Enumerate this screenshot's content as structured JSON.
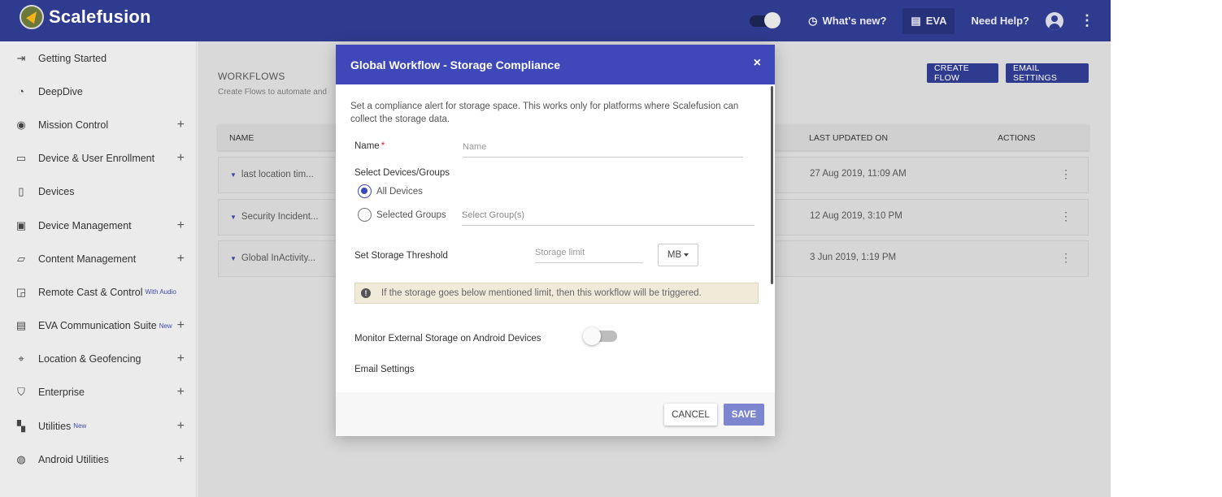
{
  "app": {
    "brand": "Scalefusion",
    "header": {
      "whats_new": "What's new?",
      "eva": "EVA",
      "need_help": "Need Help?"
    }
  },
  "sidebar": {
    "items": [
      {
        "label": "Getting Started",
        "icon": "sign-in-icon",
        "expandable": false,
        "badge": ""
      },
      {
        "label": "DeepDive",
        "icon": "gauge-icon",
        "expandable": false,
        "badge": ""
      },
      {
        "label": "Mission Control",
        "icon": "target-icon",
        "expandable": true,
        "badge": ""
      },
      {
        "label": "Device & User Enrollment",
        "icon": "devices-icon",
        "expandable": true,
        "badge": ""
      },
      {
        "label": "Devices",
        "icon": "phone-icon",
        "expandable": false,
        "badge": ""
      },
      {
        "label": "Device Management",
        "icon": "briefcase-icon",
        "expandable": true,
        "badge": ""
      },
      {
        "label": "Content Management",
        "icon": "folder-icon",
        "expandable": true,
        "badge": ""
      },
      {
        "label": "Remote Cast & Control",
        "icon": "cast-icon",
        "expandable": false,
        "badge": "With Audio"
      },
      {
        "label": "EVA Communication Suite",
        "icon": "chat-icon",
        "expandable": true,
        "badge": "New"
      },
      {
        "label": "Location & Geofencing",
        "icon": "map-pin-icon",
        "expandable": true,
        "badge": ""
      },
      {
        "label": "Enterprise",
        "icon": "shield-icon",
        "expandable": true,
        "badge": ""
      },
      {
        "label": "Utilities",
        "icon": "widgets-icon",
        "expandable": true,
        "badge": "New"
      },
      {
        "label": "Android Utilities",
        "icon": "android-icon",
        "expandable": true,
        "badge": ""
      }
    ],
    "plus": "+"
  },
  "workflows": {
    "title": "WORKFLOWS",
    "subtitle": "Create Flows to automate and",
    "create_flow": "CREATE FLOW",
    "email_settings": "EMAIL SETTINGS",
    "columns": {
      "name": "NAME",
      "last_updated": "LAST UPDATED ON",
      "actions": "ACTIONS"
    },
    "rows": [
      {
        "name": "last location tim...",
        "updated": "27 Aug 2019, 11:09 AM"
      },
      {
        "name": "Security Incident...",
        "updated": "12 Aug 2019, 3:10 PM"
      },
      {
        "name": "Global InActivity...",
        "updated": "3 Jun 2019, 1:19 PM"
      }
    ]
  },
  "modal": {
    "title": "Global Workflow - Storage Compliance",
    "close": "×",
    "description": "Set a compliance alert for storage space. This works only for platforms where Scalefusion can collect the storage data.",
    "name_label": "Name",
    "required_mark": "*",
    "name_placeholder": "Name",
    "select_label": "Select Devices/Groups",
    "opt_all": "All Devices",
    "opt_groups": "Selected Groups",
    "groups_placeholder": "Select Group(s)",
    "threshold_label": "Set Storage Threshold",
    "storage_placeholder": "Storage limit",
    "unit": "MB",
    "info_text": "If the storage goes below mentioned limit, then this workflow will be triggered.",
    "info_icon": "!",
    "monitor_label": "Monitor External Storage on Android Devices",
    "email_label": "Email Settings",
    "cancel": "CANCEL",
    "save": "SAVE"
  }
}
